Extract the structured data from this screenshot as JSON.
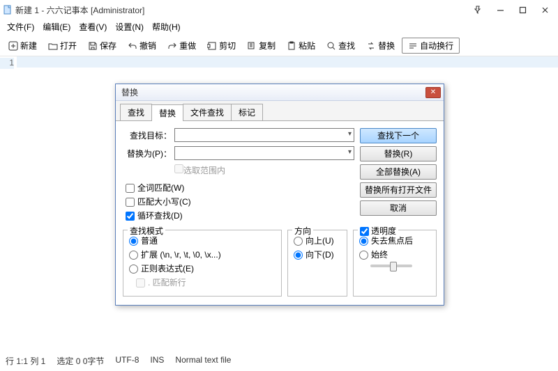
{
  "window": {
    "title": "新建 1 - 六六记事本 [Administrator]"
  },
  "menu": {
    "file": "文件(F)",
    "edit": "编辑(E)",
    "view": "查看(V)",
    "settings": "设置(N)",
    "help": "帮助(H)"
  },
  "toolbar": {
    "new": "新建",
    "open": "打开",
    "save": "保存",
    "undo": "撤销",
    "redo": "重做",
    "cut": "剪切",
    "copy": "复制",
    "paste": "粘贴",
    "find": "查找",
    "replace": "替换",
    "wrap": "自动换行"
  },
  "editor": {
    "line1": "1"
  },
  "status": {
    "pos": "行 1:1  列 1",
    "sel": "选定 0   0字节",
    "enc": "UTF-8",
    "mode": "INS",
    "lang": "Normal text file"
  },
  "dialog": {
    "title": "替换",
    "tabs": {
      "find": "查找",
      "replace": "替换",
      "filefind": "文件查找",
      "mark": "标记"
    },
    "find_label": "查找目标：",
    "replace_label": "替换为(P)：",
    "in_selection": "选取范围内",
    "btn_findnext": "查找下一个",
    "btn_replace": "替换(R)",
    "btn_replaceall": "全部替换(A)",
    "btn_replaceopen": "替换所有打开文件",
    "btn_cancel": "取消",
    "chk_whole": "全词匹配(W)",
    "chk_case": "匹配大小写(C)",
    "chk_loop": "循环查找(D)",
    "grp_mode": "查找模式",
    "mode_normal": "普通",
    "mode_ext": "扩展 (\\n, \\r, \\t, \\0, \\x...)",
    "mode_regex": "正则表达式(E)",
    "mode_newline": ". 匹配新行",
    "grp_dir": "方向",
    "dir_up": "向上(U)",
    "dir_down": "向下(D)",
    "grp_trans": "透明度",
    "trans_lose": "失去焦点后",
    "trans_always": "始终"
  }
}
